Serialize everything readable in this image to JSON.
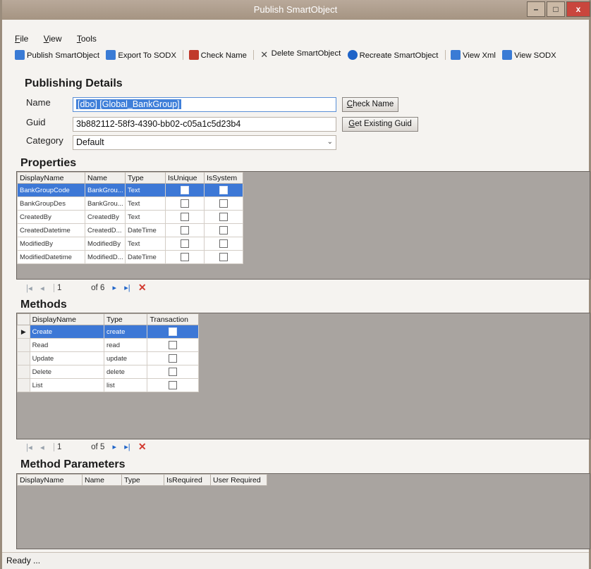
{
  "window": {
    "title": "Publish SmartObject",
    "controls": {
      "minimize": "–",
      "maximize": "□",
      "close": "x"
    }
  },
  "menu": {
    "items": [
      {
        "key": "F",
        "rest": "ile"
      },
      {
        "key": "V",
        "rest": "iew"
      },
      {
        "key": "T",
        "rest": "ools"
      }
    ]
  },
  "toolbar": {
    "items": [
      {
        "label": "Publish SmartObject",
        "icon": "publish-icon",
        "color": "#3a7bd5"
      },
      {
        "label": "Export To SODX",
        "icon": "export-icon",
        "color": "#3a7bd5"
      },
      {
        "label": "Check Name",
        "icon": "check-name-icon",
        "color": "#c0392b"
      },
      {
        "label": "Delete SmartObject",
        "icon": "delete-icon",
        "color": "#444444"
      },
      {
        "label": "Recreate SmartObject",
        "icon": "recreate-icon",
        "color": "#1f64c8"
      },
      {
        "label": "View Xml",
        "icon": "xml-icon",
        "color": "#3a7bd5"
      },
      {
        "label": "View SODX",
        "icon": "sodx-icon",
        "color": "#3a7bd5"
      }
    ]
  },
  "publishing": {
    "heading": "Publishing Details",
    "name_label": "Name",
    "name_value": "[dbo] [Global_BankGroup]",
    "check_name_button_key": "C",
    "check_name_button_rest": "heck Name",
    "guid_label": "Guid",
    "guid_value": "3b882112-58f3-4390-bb02-c05a1c5d23b4",
    "get_guid_button_key": "G",
    "get_guid_button_rest": "et Existing Guid",
    "category_label": "Category",
    "category_value": "Default",
    "category_chevron": "⌄"
  },
  "properties": {
    "heading": "Properties",
    "columns": [
      "DisplayName",
      "Name",
      "Type",
      "IsUnique",
      "IsSystem"
    ],
    "rows": [
      {
        "display": "BankGroupCode",
        "name": "BankGrou...",
        "type": "Text",
        "selected": true
      },
      {
        "display": "BankGroupDes",
        "name": "BankGrou...",
        "type": "Text",
        "selected": false
      },
      {
        "display": "CreatedBy",
        "name": "CreatedBy",
        "type": "Text",
        "selected": false
      },
      {
        "display": "CreatedDatetime",
        "name": "CreatedD...",
        "type": "DateTime",
        "selected": false
      },
      {
        "display": "ModifiedBy",
        "name": "ModifiedBy",
        "type": "Text",
        "selected": false
      },
      {
        "display": "ModifiedDatetime",
        "name": "ModifiedD...",
        "type": "DateTime",
        "selected": false
      }
    ],
    "nav": {
      "first": "|◂",
      "prev": "◂",
      "position": "1",
      "of": "of 6",
      "next": "▸",
      "last": "▸|",
      "delete": "✕"
    }
  },
  "methods": {
    "heading": "Methods",
    "columns": [
      "DisplayName",
      "Type",
      "Transaction"
    ],
    "rows": [
      {
        "display": "Create",
        "type": "create",
        "selected": true
      },
      {
        "display": "Read",
        "type": "read",
        "selected": false
      },
      {
        "display": "Update",
        "type": "update",
        "selected": false
      },
      {
        "display": "Delete",
        "type": "delete",
        "selected": false
      },
      {
        "display": "List",
        "type": "list",
        "selected": false
      }
    ],
    "row_pointer": "▶",
    "nav": {
      "first": "|◂",
      "prev": "◂",
      "position": "1",
      "of": "of 5",
      "next": "▸",
      "last": "▸|",
      "delete": "✕"
    }
  },
  "method_parameters": {
    "heading": "Method Parameters",
    "columns": [
      "DisplayName",
      "Name",
      "Type",
      "IsRequired",
      "User Required"
    ]
  },
  "status": {
    "text": "Ready ..."
  }
}
